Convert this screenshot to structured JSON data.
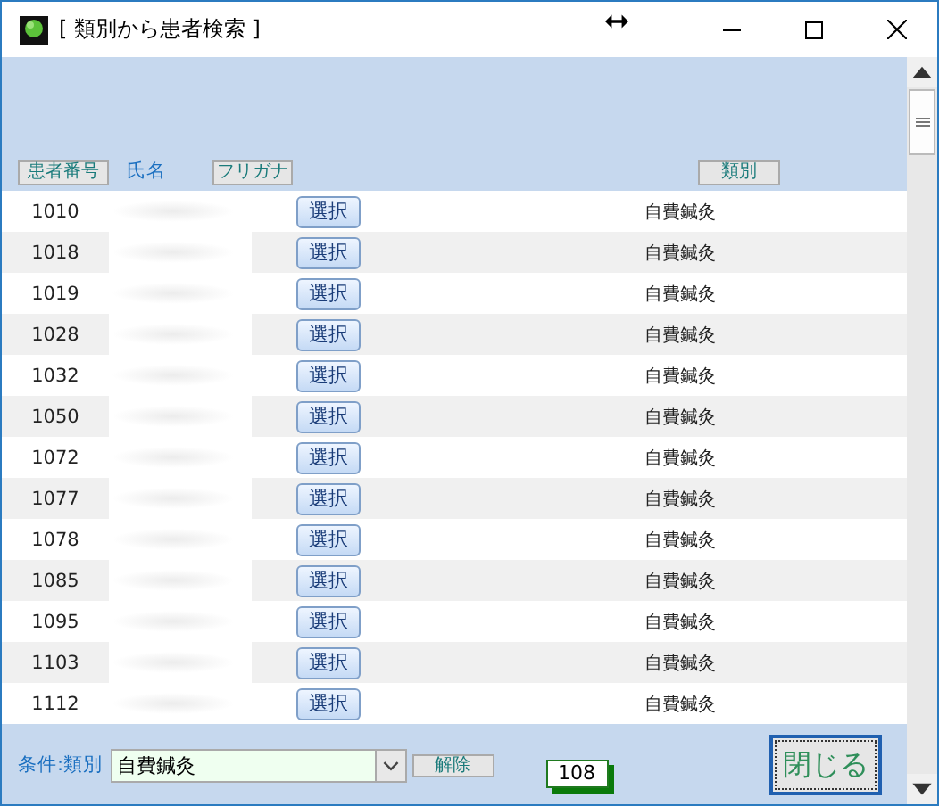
{
  "window": {
    "title": "[ 類別から患者検索 ]"
  },
  "table": {
    "columns": [
      {
        "label": "患者番号",
        "kind": "button"
      },
      {
        "label": "氏名",
        "kind": "plain"
      },
      {
        "label": "フリガナ",
        "kind": "button"
      },
      {
        "label": "類別",
        "kind": "button"
      }
    ],
    "rows": [
      {
        "number": "1010",
        "action": "選択",
        "category": "自費鍼灸"
      },
      {
        "number": "1018",
        "action": "選択",
        "category": "自費鍼灸"
      },
      {
        "number": "1019",
        "action": "選択",
        "category": "自費鍼灸"
      },
      {
        "number": "1028",
        "action": "選択",
        "category": "自費鍼灸"
      },
      {
        "number": "1032",
        "action": "選択",
        "category": "自費鍼灸"
      },
      {
        "number": "1050",
        "action": "選択",
        "category": "自費鍼灸"
      },
      {
        "number": "1072",
        "action": "選択",
        "category": "自費鍼灸"
      },
      {
        "number": "1077",
        "action": "選択",
        "category": "自費鍼灸"
      },
      {
        "number": "1078",
        "action": "選択",
        "category": "自費鍼灸"
      },
      {
        "number": "1085",
        "action": "選択",
        "category": "自費鍼灸"
      },
      {
        "number": "1095",
        "action": "選択",
        "category": "自費鍼灸"
      },
      {
        "number": "1103",
        "action": "選択",
        "category": "自費鍼灸"
      },
      {
        "number": "1112",
        "action": "選択",
        "category": "自費鍼灸"
      }
    ]
  },
  "footer": {
    "filter_label": "条件:類別",
    "filter_value": "自費鍼灸",
    "clear_button": "解除",
    "count": "108",
    "close_button": "閉じる"
  }
}
